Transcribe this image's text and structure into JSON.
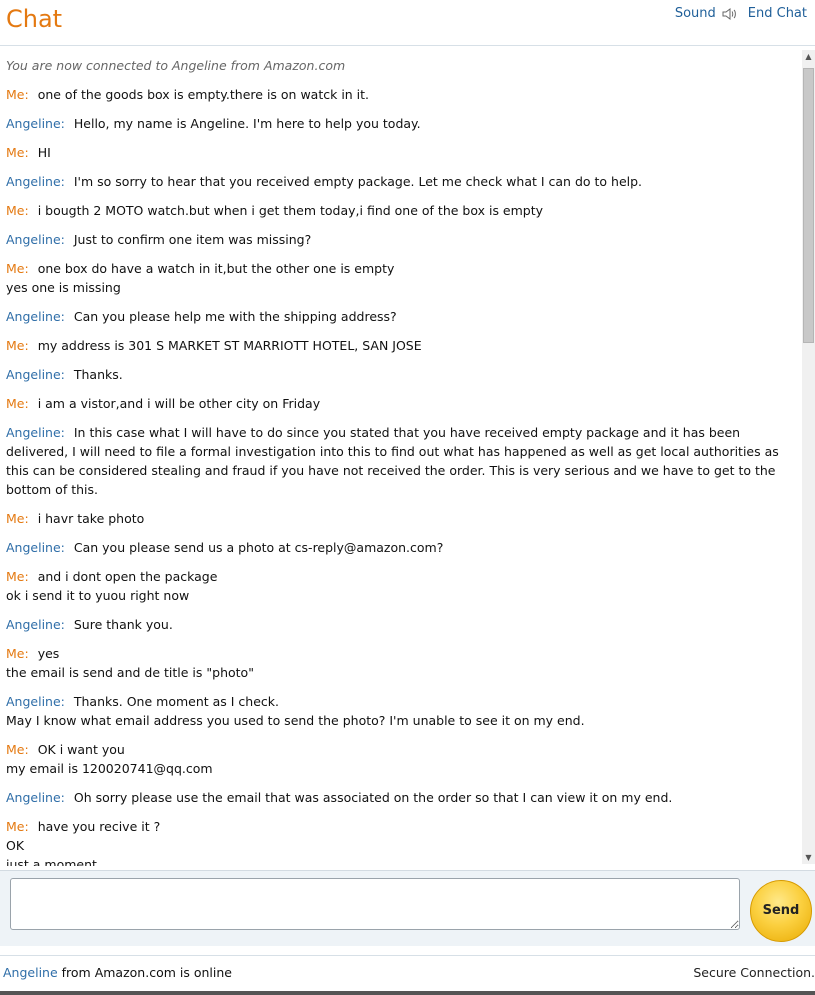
{
  "header": {
    "title": "Chat",
    "sound_label": "Sound",
    "end_chat_label": "End Chat",
    "sound_icon": "speaker-icon"
  },
  "transcript": {
    "status": "You are now connected to Angeline from Amazon.com",
    "messages": [
      {
        "who": "Me:",
        "text": "one of the goods box is empty.there is on watck in it."
      },
      {
        "who": "Angeline:",
        "text": "Hello, my name is Angeline. I'm here to help you today."
      },
      {
        "who": "Me:",
        "text": "HI"
      },
      {
        "who": "Angeline:",
        "text": "I'm so sorry to hear that you received empty package. Let me check what I can do to help."
      },
      {
        "who": "Me:",
        "text": "i bougth 2 MOTO watch.but when i get them today,i find one of the box is empty"
      },
      {
        "who": "Angeline:",
        "text": "Just to confirm one item was missing?"
      },
      {
        "who": "Me:",
        "text": "one box do have a watch in it,but the other one is empty",
        "extra": [
          "yes one is missing"
        ]
      },
      {
        "who": "Angeline:",
        "text": "Can you please help me with the shipping address?"
      },
      {
        "who": "Me:",
        "text": "my address is 301 S MARKET ST MARRIOTT HOTEL, SAN JOSE"
      },
      {
        "who": "Angeline:",
        "text": "Thanks."
      },
      {
        "who": "Me:",
        "text": "i am a vistor,and i will be other city on Friday"
      },
      {
        "who": "Angeline:",
        "text": "In this case what I will have to do since you stated that you have received empty package and it has been delivered, I will need to file a formal investigation into this to find out what has happened as well as get local authorities as this can be considered stealing and fraud if you have not received the order. This is very serious and we have to get to the bottom of this."
      },
      {
        "who": "Me:",
        "text": "i havr take photo"
      },
      {
        "who": "Angeline:",
        "text": "Can you please send us a photo at cs-reply@amazon.com?"
      },
      {
        "who": "Me:",
        "text": "and i dont open the package",
        "extra": [
          "ok i send it to yuou right now"
        ]
      },
      {
        "who": "Angeline:",
        "text": "Sure thank you."
      },
      {
        "who": "Me:",
        "text": "yes",
        "extra": [
          "the email is send and de title is \"photo\""
        ]
      },
      {
        "who": "Angeline:",
        "text": "Thanks. One moment as I check.",
        "extra": [
          "May I know what email address you used to send the photo? I'm unable to see it on my end."
        ]
      },
      {
        "who": "Me:",
        "text": "OK i want you",
        "extra": [
          "my email is 120020741@qq.com"
        ]
      },
      {
        "who": "Angeline:",
        "text": "Oh sorry please use the email that was associated on the order so that I can view it on my end."
      },
      {
        "who": "Me:",
        "text": "have you recive it ?",
        "extra": [
          "OK",
          "just a moment"
        ]
      }
    ]
  },
  "input": {
    "value": "",
    "send_label": "Send"
  },
  "footer": {
    "agent_name": "Angeline",
    "online_text": " from Amazon.com is online",
    "secure_text": "Secure Connection."
  },
  "colors": {
    "title": "#e47911",
    "me": "#e47911",
    "agent": "#2f6ea8",
    "link": "#1f5f99"
  }
}
